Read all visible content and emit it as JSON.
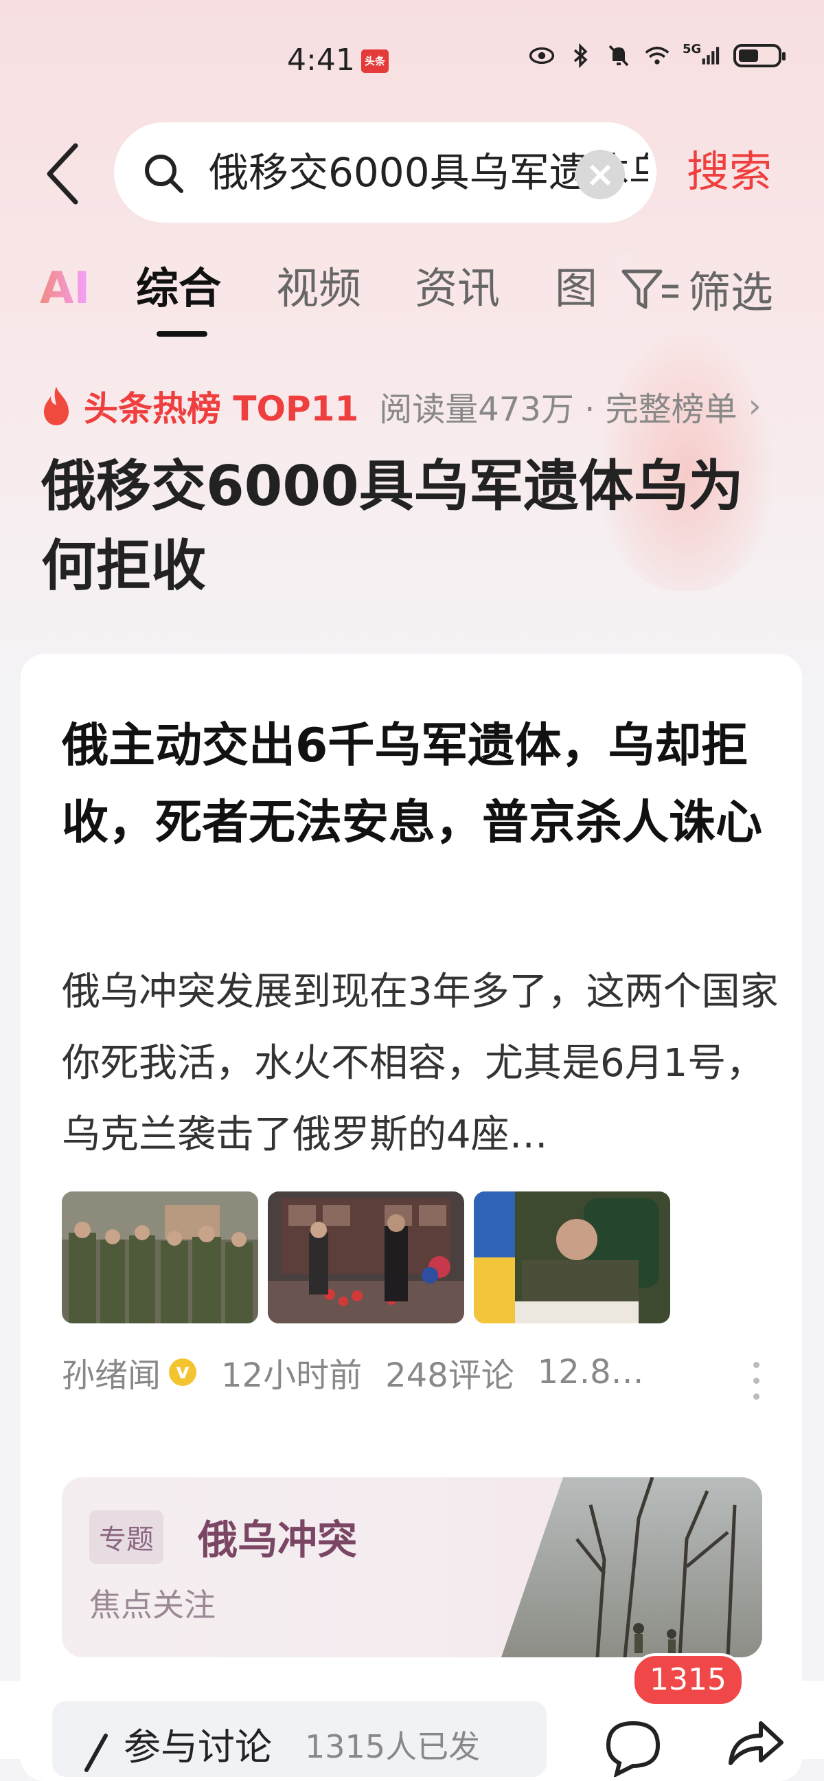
{
  "status_bar": {
    "time": "4:41",
    "app_badge": "头条",
    "network": "5G",
    "icons": [
      "eye-icon",
      "bluetooth-icon",
      "mute-icon",
      "wifi-icon",
      "signal-icon",
      "battery-icon"
    ]
  },
  "search": {
    "query": "俄移交6000具乌军遗体乌为何拒收",
    "submit_label": "搜索"
  },
  "tabs": {
    "ai": "AI",
    "items": [
      "综合",
      "视频",
      "资讯",
      "图"
    ],
    "active": "综合",
    "filter_label": "筛选"
  },
  "hot": {
    "label": "头条热榜 TOP11",
    "meta": "阅读量473万 · 完整榜单",
    "topic_title": "俄移交6000具乌军遗体乌为何拒收"
  },
  "article": {
    "title": "俄主动交出6千乌军遗体，乌却拒收，死者无法安息，普京杀人诛心",
    "summary": "俄乌冲突发展到现在3年多了，这两个国家你死我活，水火不相容，尤其是6月1号，乌克兰袭击了俄罗斯的4座…",
    "author": "孙绪闻",
    "time": "12小时前",
    "comments": "248评论",
    "reads": "12.8…"
  },
  "topic_card": {
    "tag": "专题",
    "name": "俄乌冲突",
    "subtitle": "焦点关注"
  },
  "bottom": {
    "discuss_label": "参与讨论",
    "discuss_count": "1315人已发",
    "comment_badge": "1315"
  },
  "colors": {
    "accent_red": "#ef3e3e",
    "topic_purple": "#7a4664"
  }
}
